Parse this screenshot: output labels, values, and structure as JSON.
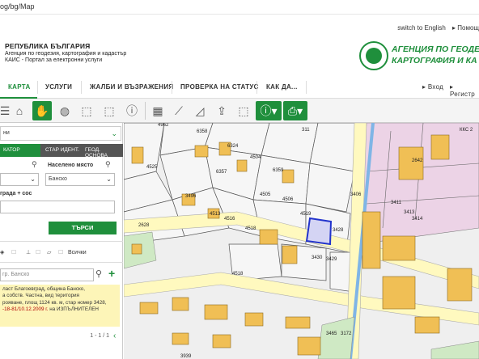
{
  "url": {
    "text": "og/bg/Map"
  },
  "header": {
    "switch_english": "switch to English",
    "help": "▸ Помощ",
    "title_line1": "РЕПУБЛИКА БЪЛГАРИЯ",
    "title_line2": "Агенция по геодезия, картография и кадастър",
    "title_line3": "КАИС - Портал за електронни услуги",
    "agency_line1": "АГЕНЦИЯ ПО ГЕОДЕЗ",
    "agency_line2": "КАРТОГРАФИЯ И КА"
  },
  "nav": {
    "items": [
      "КАРТА",
      "УСЛУГИ",
      "ЖАЛБИ И ВЪЗРАЖЕНИЯ",
      "ПРОВЕРКА НА СТАТУС",
      "КАК ДА..."
    ],
    "login": "▸ Вход",
    "register": "▸ Регистр"
  },
  "panel": {
    "select_value": "ни",
    "tabs": [
      "КАТОР",
      "СТАР ИДЕНТ.",
      "ГЕОД. ОСНОВА"
    ],
    "settlement_label": "Населено място",
    "settlement_value": "Банско",
    "street_label": "града + сос",
    "search_button": "ТЪРСИ",
    "all_label": "Всички",
    "search2_placeholder": "гр. Банско",
    "result_line1": "ласт Благоевград, община Банско,",
    "result_line2": "а собств. Частна, вид територия",
    "result_line3": "рояване, площ 1124 кв. м, стар номер 3428,",
    "result_decree": "-18-81/10.12.2009 г.",
    "result_line4_rest": " на ИЗПЪЛНИТЕЛЕН",
    "pager": "1 - 1 / 1"
  },
  "map": {
    "labels": {
      "p4962": "4962",
      "p6358": "6358",
      "p311": "311",
      "p6324": "6324",
      "p4504": "4504",
      "p4525": "4525",
      "p6357": "6357",
      "p6359": "6359",
      "p4505": "4505",
      "p4506": "4506",
      "p3496": "3496",
      "p4513": "4513",
      "p4516": "4516",
      "p4518": "4518",
      "p4519": "4519",
      "p3428": "3428",
      "p3406": "3406",
      "p3430": "3430",
      "p3429": "3429",
      "p2628": "2628",
      "p2642": "2642",
      "p4518b": "4518",
      "p3465": "3465",
      "p3172": "3172",
      "p3939": "3939",
      "pKKC": "ККС 2",
      "p3413": "3413",
      "p3411": "3411",
      "p3414": "3414"
    }
  },
  "colors": {
    "accent": "#1f8f3c",
    "parcel_fill": "#f3f3f3",
    "building": "#f0c060",
    "road": "#fffac0"
  }
}
